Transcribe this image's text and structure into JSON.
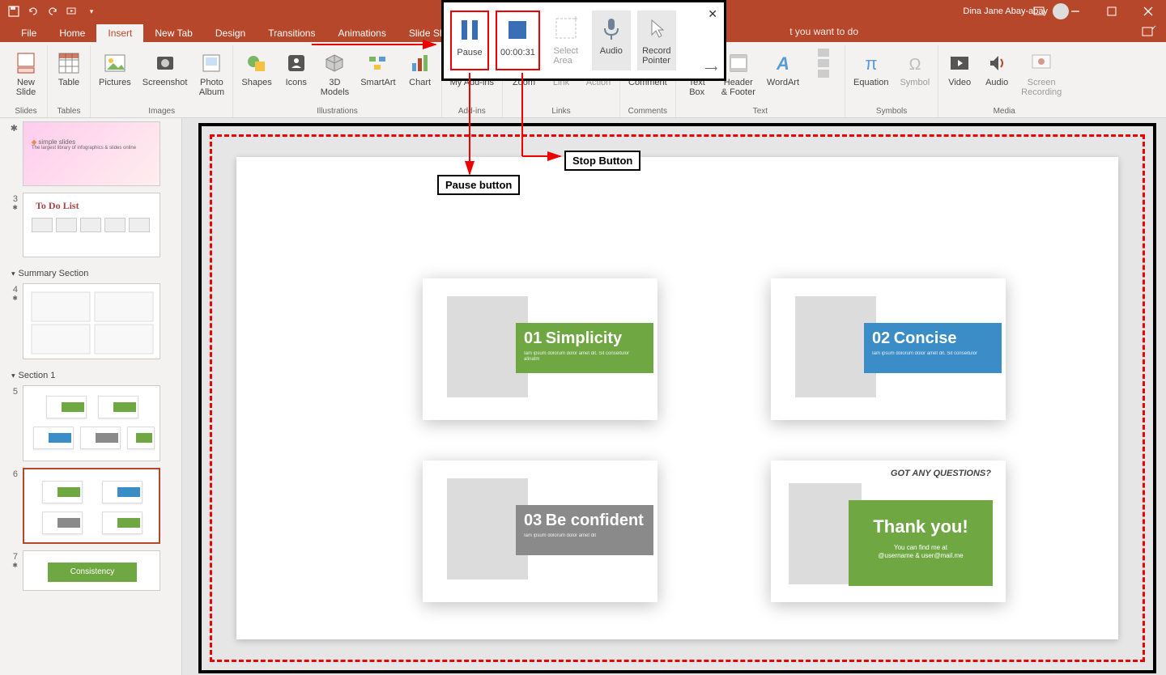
{
  "user_name": "Dina Jane Abay-abay",
  "tabs": {
    "file": "File",
    "home": "Home",
    "insert": "Insert",
    "newtab": "New Tab",
    "design": "Design",
    "transitions": "Transitions",
    "animations": "Animations",
    "slideshow": "Slide Show"
  },
  "tell_me": "t you want to do",
  "ribbon": {
    "new_slide": "New\nSlide",
    "table": "Table",
    "pictures": "Pictures",
    "screenshot": "Screenshot",
    "photo_album": "Photo\nAlbum",
    "shapes": "Shapes",
    "icons": "Icons",
    "models": "3D\nModels",
    "smartart": "SmartArt",
    "chart": "Chart",
    "addins": "My Add-ins",
    "zoom": "Zoom",
    "link": "Link",
    "action": "Action",
    "comment": "Comment",
    "textbox": "Text\nBox",
    "headerfooter": "Header\n& Footer",
    "wordart": "WordArt",
    "equation": "Equation",
    "symbol": "Symbol",
    "video": "Video",
    "audio": "Audio",
    "screen_rec": "Screen\nRecording",
    "g_slides": "Slides",
    "g_tables": "Tables",
    "g_images": "Images",
    "g_illust": "Illustrations",
    "g_addins": "Add-ins",
    "g_links": "Links",
    "g_comments": "Comments",
    "g_text": "Text",
    "g_symbols": "Symbols",
    "g_media": "Media"
  },
  "rec": {
    "pause": "Pause",
    "timer": "00:00:31",
    "select_area": "Select\nArea",
    "audio": "Audio",
    "record_pointer": "Record\nPointer"
  },
  "annot": {
    "pause": "Pause button",
    "stop": "Stop Button"
  },
  "sections": {
    "summary": "Summary Section",
    "section1": "Section 1"
  },
  "thumbs": {
    "n3": "3",
    "n4": "4",
    "n5": "5",
    "n6": "6",
    "n7": "7",
    "todo": "To Do List",
    "consistency": "Consistency",
    "simple_title": "simple slides",
    "simple_sub": "The largest library of\ninfographics & slides online"
  },
  "slide_cards": {
    "c1_num": "01",
    "c1_title": "Simplicity",
    "c1_sub": "Iam ipsum dolorum dolor amet dit. Sit conseitulor alinatm",
    "c2_num": "02",
    "c2_title": "Concise",
    "c2_sub": "Iam ipsum dolorum dolor amet dit. Sit conseitulor",
    "c3_num": "03",
    "c3_title": "Be confident",
    "c3_sub": "Iam ipsum dolorum dolor amet dit",
    "c4_q": "GOT ANY QUESTIONS?",
    "c4_title": "Thank you!",
    "c4_sub": "You can find me at\n@username & user@mail.me"
  }
}
